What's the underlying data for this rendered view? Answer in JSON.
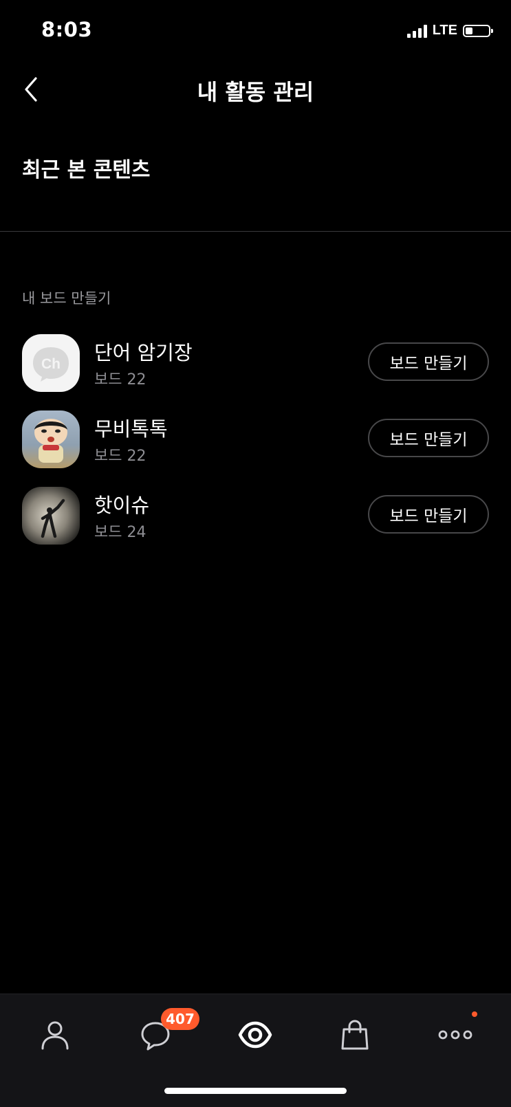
{
  "status_bar": {
    "time": "8:03",
    "network": "LTE",
    "battery_level": 0.3
  },
  "header": {
    "title": "내 활동 관리",
    "back_icon": "chevron-left-icon"
  },
  "recent": {
    "label": "최근 본 콘텐츠"
  },
  "section": {
    "label": "내 보드 만들기"
  },
  "boards": [
    {
      "name": "단어 암기장",
      "sub": "보드 22",
      "avatar_text": "Ch",
      "button": "보드 만들기"
    },
    {
      "name": "무비톡톡",
      "sub": "보드 22",
      "button": "보드 만들기"
    },
    {
      "name": "핫이슈",
      "sub": "보드 24",
      "button": "보드 만들기"
    }
  ],
  "tab_bar": {
    "items": [
      "person-icon",
      "chat-icon",
      "view-icon",
      "shopping-bag-icon",
      "more-icon"
    ],
    "chat_badge": "407",
    "accent": "#ff5a2c"
  }
}
